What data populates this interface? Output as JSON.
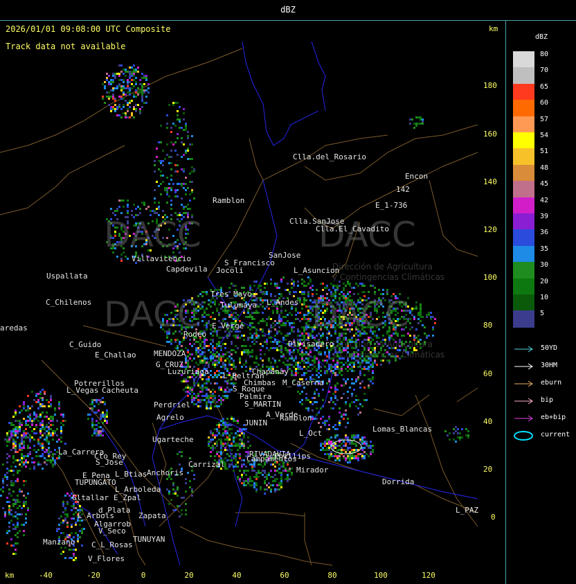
{
  "title": "dBZ",
  "timestamp": "2026/01/01 09:08:00 UTC Composite",
  "track_message": "Track data not available",
  "axis": {
    "unit": "km",
    "y_ticks": [
      "180",
      "160",
      "140",
      "120",
      "100",
      "80",
      "60",
      "40",
      "20",
      "0"
    ],
    "x_ticks": [
      "-40",
      "-20",
      "0",
      "20",
      "40",
      "60",
      "80",
      "100",
      "120"
    ]
  },
  "legend": {
    "title": "dBZ",
    "levels": [
      {
        "label": "80",
        "color": "#d9d9d9"
      },
      {
        "label": "70",
        "color": "#bfbfbf"
      },
      {
        "label": "65",
        "color": "#ff3a1e"
      },
      {
        "label": "60",
        "color": "#ff6a00"
      },
      {
        "label": "57",
        "color": "#ff9a55"
      },
      {
        "label": "54",
        "color": "#ffff00"
      },
      {
        "label": "51",
        "color": "#f7c12a"
      },
      {
        "label": "48",
        "color": "#d98c3a"
      },
      {
        "label": "45",
        "color": "#c0708a"
      },
      {
        "label": "42",
        "color": "#d21ec8"
      },
      {
        "label": "39",
        "color": "#8a1ed2"
      },
      {
        "label": "36",
        "color": "#2a4bdc"
      },
      {
        "label": "35",
        "color": "#1e8ce6"
      },
      {
        "label": "30",
        "color": "#1e8c1e"
      },
      {
        "label": "20",
        "color": "#0e7810"
      },
      {
        "label": "10",
        "color": "#0a5a0a"
      },
      {
        "label": "5",
        "color": "#3c3c8c"
      }
    ],
    "tracks": [
      {
        "label": "50YD",
        "color": "#4fd4e0"
      },
      {
        "label": "30HM",
        "color": "#ffffff"
      },
      {
        "label": "eburn",
        "color": "#e8b060"
      },
      {
        "label": "bip",
        "color": "#ffb0d0"
      },
      {
        "label": "eb+bip",
        "color": "#e040e0"
      },
      {
        "label": "current",
        "color": "#00e0ff"
      }
    ]
  },
  "places": [
    {
      "name": "Clla.del_Rosario"
    },
    {
      "name": "Encon"
    },
    {
      "name": "142"
    },
    {
      "name": "E_1-736"
    },
    {
      "name": "Ramblon"
    },
    {
      "name": "Clla.SanJose"
    },
    {
      "name": "Clla.El_Cavadito"
    },
    {
      "name": "Villavicencio"
    },
    {
      "name": "Capdevila"
    },
    {
      "name": "S_Francisco"
    },
    {
      "name": "Jocoli"
    },
    {
      "name": "SanJose"
    },
    {
      "name": "L_Asuncion"
    },
    {
      "name": "Uspallata"
    },
    {
      "name": "C_Chilenos"
    },
    {
      "name": "Tres_Mayo"
    },
    {
      "name": "Tulumaya"
    },
    {
      "name": "L_Andes"
    },
    {
      "name": "aredas"
    },
    {
      "name": "E_Verge"
    },
    {
      "name": "Rodeo"
    },
    {
      "name": "Divisadero"
    },
    {
      "name": "C_Guido"
    },
    {
      "name": "E_Challao"
    },
    {
      "name": "MENDOZA"
    },
    {
      "name": "G_CRUZ"
    },
    {
      "name": "Luzuriaga"
    },
    {
      "name": "L_Beltran"
    },
    {
      "name": "Chimbas"
    },
    {
      "name": "Chapanay"
    },
    {
      "name": "M_Caserna"
    },
    {
      "name": "Potrerillos"
    },
    {
      "name": "L_Vegas"
    },
    {
      "name": "Cacheuta"
    },
    {
      "name": "Perdriel"
    },
    {
      "name": "S_Roque"
    },
    {
      "name": "Palmira"
    },
    {
      "name": "S_MARTIN"
    },
    {
      "name": "Agrelo"
    },
    {
      "name": "A_Verde"
    },
    {
      "name": "Ramblon"
    },
    {
      "name": "JUNIN"
    },
    {
      "name": "Ugarteche"
    },
    {
      "name": "RIVADAVIA"
    },
    {
      "name": "Phillips"
    },
    {
      "name": "L_Oct"
    },
    {
      "name": "Lomas_Blancas"
    },
    {
      "name": "La_Carrera"
    },
    {
      "name": "Cto_Rey"
    },
    {
      "name": "S_Jose"
    },
    {
      "name": "Carrizal"
    },
    {
      "name": "Campamentos"
    },
    {
      "name": "Mirador"
    },
    {
      "name": "E_Pena"
    },
    {
      "name": "TUPUNGATO"
    },
    {
      "name": "L_Btias"
    },
    {
      "name": "Anchoris"
    },
    {
      "name": "Dorrida"
    },
    {
      "name": "L_Arboleda"
    },
    {
      "name": "Gltallar"
    },
    {
      "name": "E_Zpal"
    },
    {
      "name": "L_Arbols"
    },
    {
      "name": "d_Plata"
    },
    {
      "name": "Zapata"
    },
    {
      "name": "Algarrob"
    },
    {
      "name": "V_Seco"
    },
    {
      "name": "TUNUYAN"
    },
    {
      "name": "Manzano"
    },
    {
      "name": "C_L_Rosas"
    },
    {
      "name": "V_Flores"
    },
    {
      "name": "L_PAZ"
    }
  ],
  "watermark": {
    "brand": "DACC",
    "line1": "Dirección de Agricultura",
    "line2": "y Contingencias Climáticas"
  }
}
